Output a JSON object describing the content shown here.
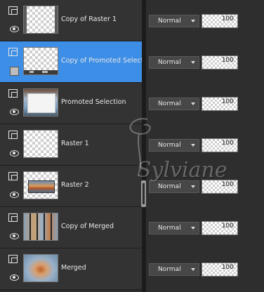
{
  "layers": [
    {
      "name": "Copy of Raster 1",
      "blend": "Normal",
      "opacity": "100",
      "selected": false
    },
    {
      "name": "Copy of Promoted Selection",
      "blend": "Normal",
      "opacity": "100",
      "selected": true
    },
    {
      "name": "Promoted Selection",
      "blend": "Normal",
      "opacity": "100",
      "selected": false
    },
    {
      "name": "Raster 1",
      "blend": "Normal",
      "opacity": "100",
      "selected": false
    },
    {
      "name": "Raster 2",
      "blend": "Normal",
      "opacity": "100",
      "selected": false
    },
    {
      "name": "Copy of Merged",
      "blend": "Normal",
      "opacity": "100",
      "selected": false
    },
    {
      "name": "Merged",
      "blend": "Normal",
      "opacity": "100",
      "selected": false
    }
  ],
  "watermark": "Sylviane",
  "colors": {
    "selected": "#3d8ee6",
    "panel": "#333333",
    "divider": "#1c1c1c"
  },
  "icons": [
    "layer-group-icon",
    "eye-icon",
    "chevron-down-icon",
    "selection-swatch-icon"
  ]
}
